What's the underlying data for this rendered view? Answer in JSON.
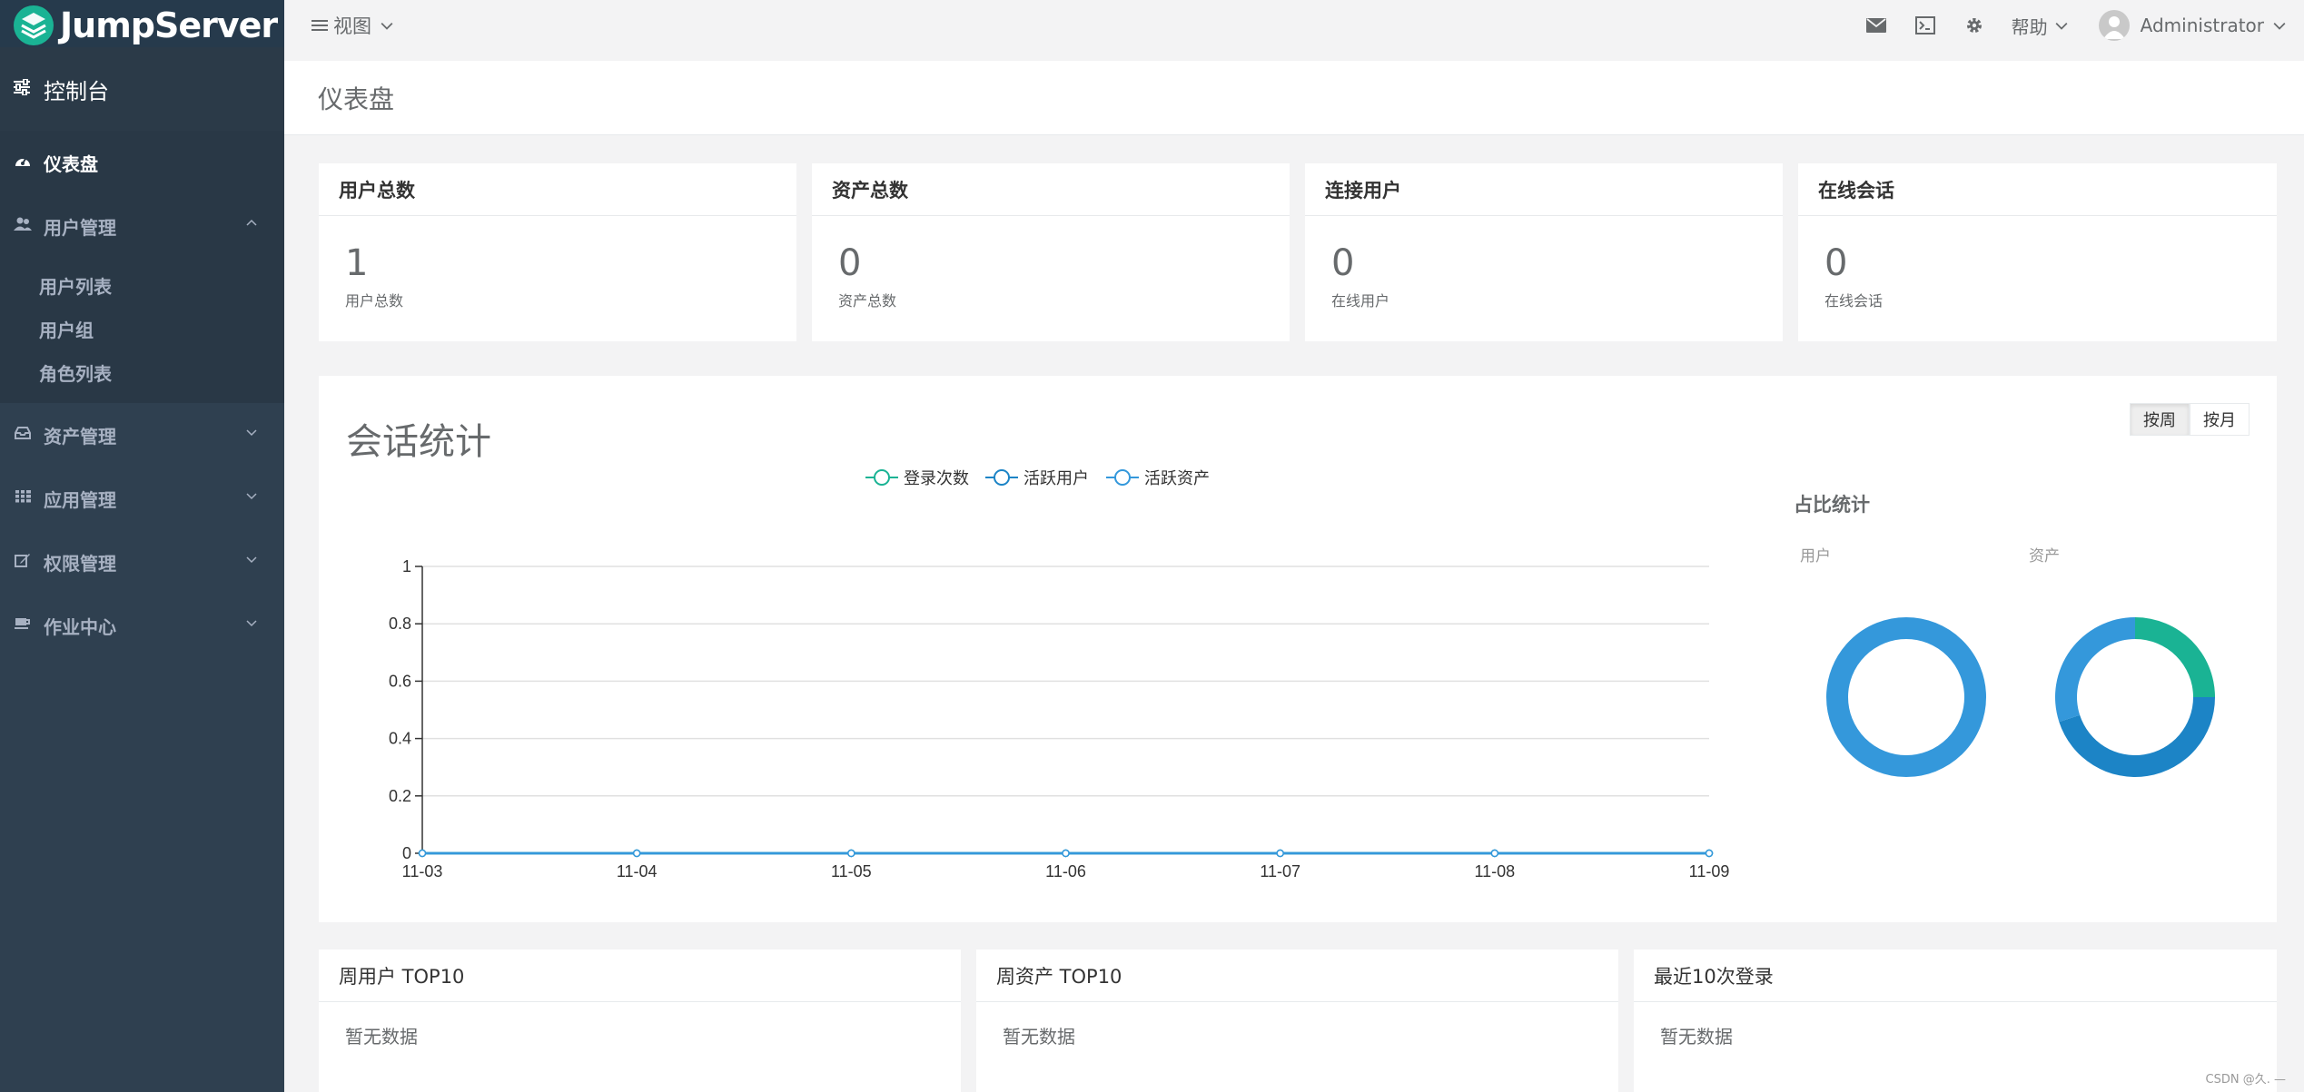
{
  "app": {
    "logo_text": "JumpServer"
  },
  "sidebar": {
    "console_label": "控制台",
    "items": [
      {
        "label": "仪表盘",
        "icon": "dashboard-icon",
        "active": true
      },
      {
        "label": "用户管理",
        "icon": "users-icon",
        "expanded": true,
        "children": [
          "用户列表",
          "用户组",
          "角色列表"
        ]
      },
      {
        "label": "资产管理",
        "icon": "inbox-icon"
      },
      {
        "label": "应用管理",
        "icon": "grid-icon"
      },
      {
        "label": "权限管理",
        "icon": "edit-icon"
      },
      {
        "label": "作业中心",
        "icon": "coffee-icon"
      }
    ]
  },
  "topbar": {
    "view_label": "视图",
    "help_label": "帮助",
    "user_name": "Administrator"
  },
  "page": {
    "title": "仪表盘"
  },
  "stats": [
    {
      "title": "用户总数",
      "value": "1",
      "label": "用户总数"
    },
    {
      "title": "资产总数",
      "value": "0",
      "label": "资产总数"
    },
    {
      "title": "连接用户",
      "value": "0",
      "label": "在线用户"
    },
    {
      "title": "在线会话",
      "value": "0",
      "label": "在线会话"
    }
  ],
  "session_chart": {
    "title": "会话统计",
    "range_buttons": [
      "按周",
      "按月"
    ],
    "active_range": "按周",
    "ratio_title": "占比统计",
    "ratio_labels": [
      "用户",
      "资产"
    ]
  },
  "chart_data": [
    {
      "type": "line",
      "x": [
        "11-03",
        "11-04",
        "11-05",
        "11-06",
        "11-07",
        "11-08",
        "11-09"
      ],
      "ylim": [
        0,
        1
      ],
      "yticks": [
        0,
        0.2,
        0.4,
        0.6,
        0.8,
        1
      ],
      "legend_position": "top-center",
      "grid": true,
      "series": [
        {
          "name": "登录次数",
          "values": [
            0,
            0,
            0,
            0,
            0,
            0,
            0
          ],
          "color": "#1ab394"
        },
        {
          "name": "活跃用户",
          "values": [
            0,
            0,
            0,
            0,
            0,
            0,
            0
          ],
          "color": "#1c84c6"
        },
        {
          "name": "活跃资产",
          "values": [
            0,
            0,
            0,
            0,
            0,
            0,
            0
          ],
          "color": "#3498db"
        }
      ]
    },
    {
      "type": "pie",
      "title": "用户",
      "slices": [
        {
          "value": 1,
          "color": "#3498db"
        }
      ]
    },
    {
      "type": "pie",
      "title": "资产",
      "slices": [
        {
          "value": 0.25,
          "color": "#1ab394"
        },
        {
          "value": 0.45,
          "color": "#1c84c6"
        },
        {
          "value": 0.3,
          "color": "#3498db"
        }
      ]
    }
  ],
  "bottom_panels": [
    {
      "title": "周用户 TOP10",
      "empty_text": "暂无数据"
    },
    {
      "title": "周资产 TOP10",
      "empty_text": "暂无数据"
    },
    {
      "title": "最近10次登录",
      "empty_text": "暂无数据"
    }
  ],
  "watermark": "CSDN @久. —"
}
